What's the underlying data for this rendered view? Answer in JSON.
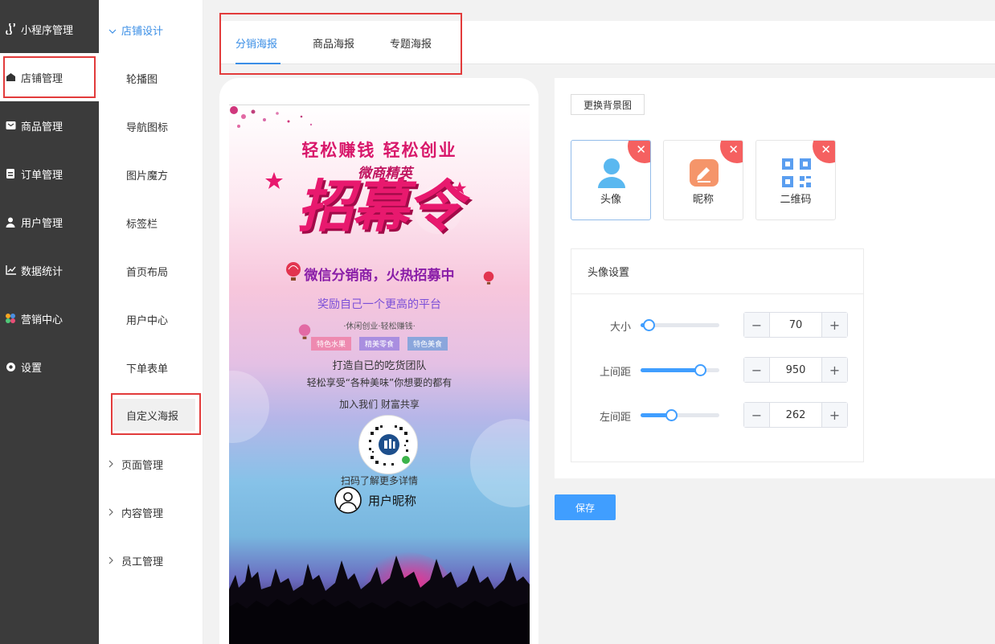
{
  "sidebar": {
    "items": [
      {
        "label": "小程序管理",
        "icon": "miniprogram-icon"
      },
      {
        "label": "店铺管理",
        "icon": "store-icon"
      },
      {
        "label": "商品管理",
        "icon": "goods-icon"
      },
      {
        "label": "订单管理",
        "icon": "order-icon"
      },
      {
        "label": "用户管理",
        "icon": "user-icon"
      },
      {
        "label": "数据统计",
        "icon": "chart-icon"
      },
      {
        "label": "营销中心",
        "icon": "marketing-icon"
      },
      {
        "label": "设置",
        "icon": "settings-icon"
      }
    ]
  },
  "subnav": {
    "open_group": "店铺设计",
    "items": [
      "轮播图",
      "导航图标",
      "图片魔方",
      "标签栏",
      "首页布局",
      "用户中心",
      "下单表单",
      "自定义海报"
    ],
    "groups": [
      "页面管理",
      "内容管理",
      "员工管理"
    ]
  },
  "tabs": [
    "分销海报",
    "商品海报",
    "专题海报"
  ],
  "poster": {
    "line1": "轻松赚钱 轻松创业",
    "line2": "微商精英",
    "line3": "招幕令",
    "line4": "微信分销商，火热招募中",
    "line5": "奖励自己一个更高的平台",
    "line6": "·休闲创业·轻松赚钱·",
    "tags": [
      "特色水果",
      "精美零食",
      "特色美食"
    ],
    "line7": "打造自已的吃货团队",
    "line8": "轻松享受“各种美味”你想要的都有",
    "line9": "加入我们 财富共享",
    "scan_text": "扫码了解更多详情",
    "nickname": "用户昵称"
  },
  "settings": {
    "change_bg_label": "更换背景图",
    "cards": [
      {
        "label": "头像",
        "icon": "avatar-icon"
      },
      {
        "label": "昵称",
        "icon": "nickname-icon"
      },
      {
        "label": "二维码",
        "icon": "qrcode-icon"
      }
    ],
    "panel_title": "头像设置",
    "rows": [
      {
        "label": "大小",
        "value": "70",
        "slider_fraction": 0.1
      },
      {
        "label": "上间距",
        "value": "950",
        "slider_fraction": 0.76
      },
      {
        "label": "左间距",
        "value": "262",
        "slider_fraction": 0.39
      }
    ],
    "minus": "−",
    "plus": "+",
    "save_label": "保存"
  },
  "colors": {
    "accent": "#409eff",
    "sidebar": "#3b3b3b",
    "highlight": "#e23b3b",
    "remove": "#f56060"
  }
}
